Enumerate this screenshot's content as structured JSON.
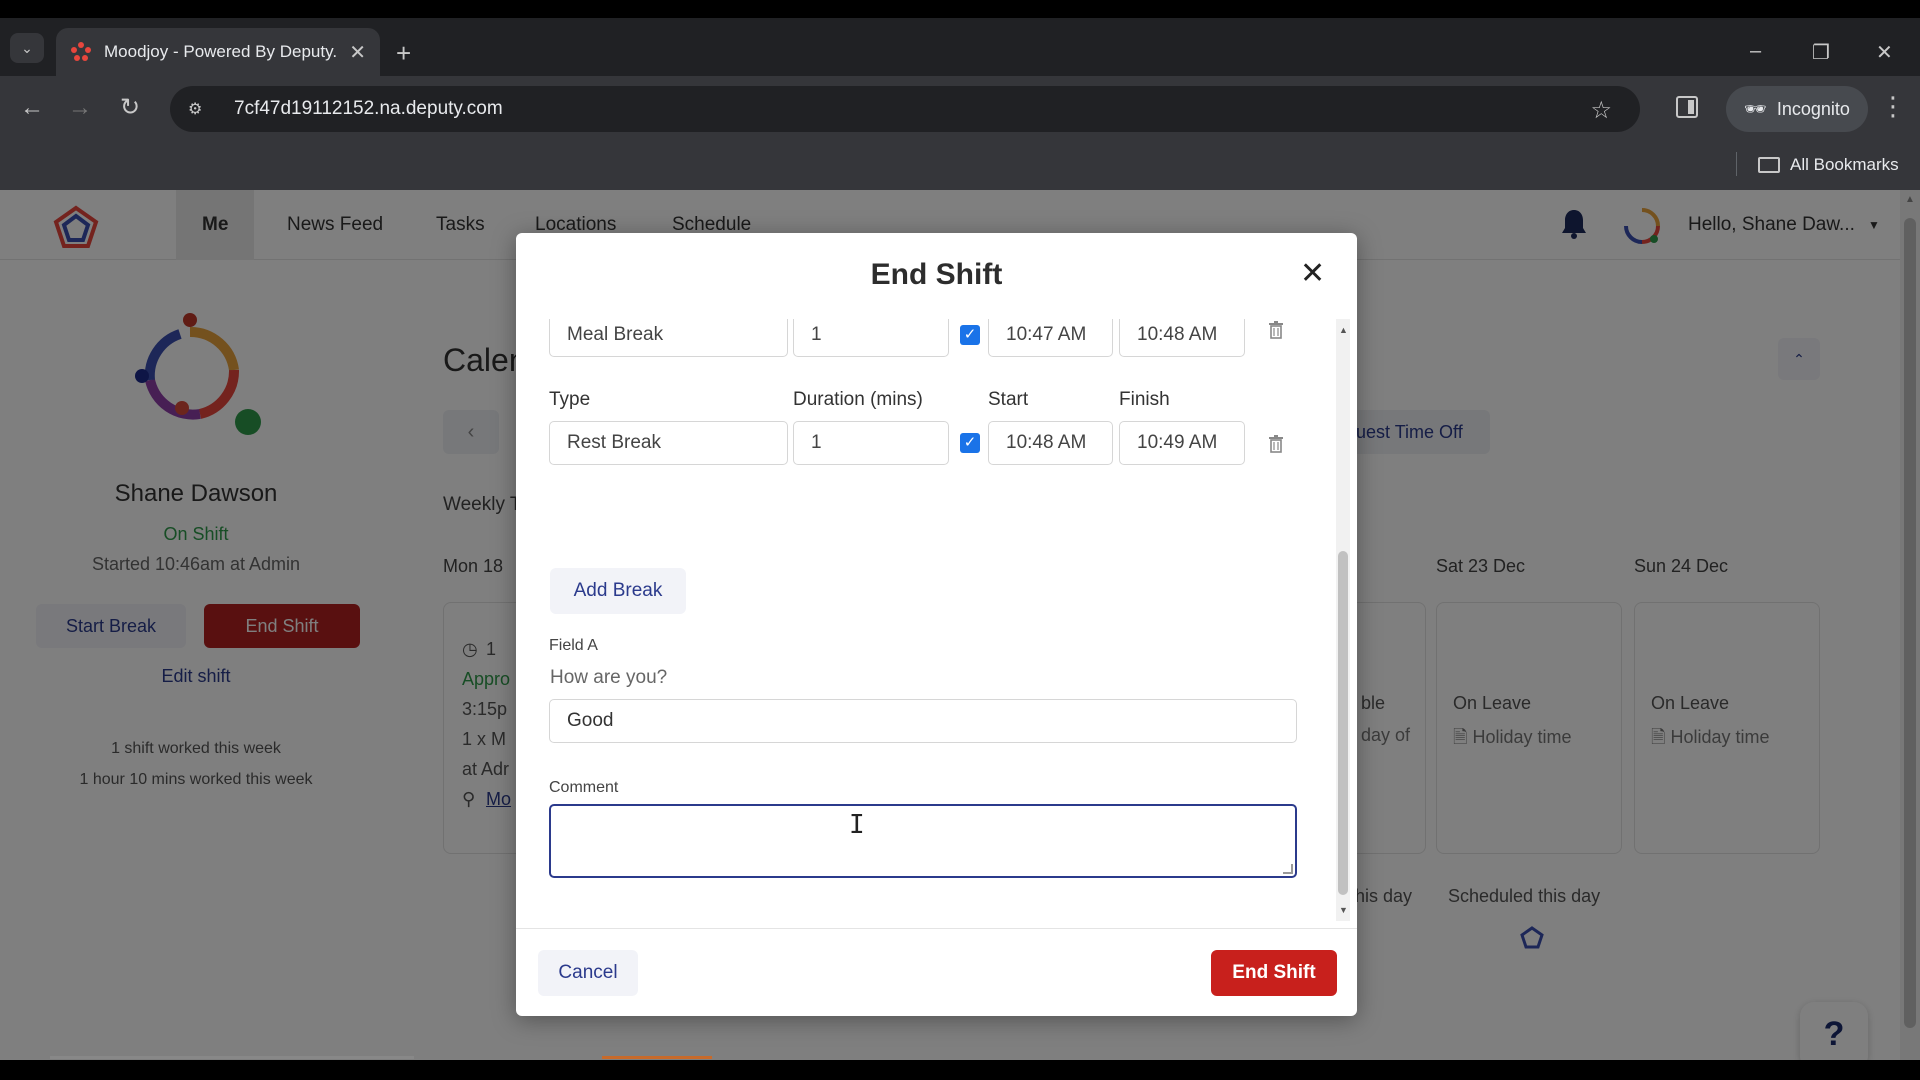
{
  "browser": {
    "tab_title": "Moodjoy - Powered By Deputy.",
    "url": "7cf47d19112152.na.deputy.com",
    "incognito_label": "Incognito",
    "bookmarks_label": "All Bookmarks"
  },
  "header": {
    "nav": [
      "Me",
      "News Feed",
      "Tasks",
      "Locations",
      "Schedule"
    ],
    "greeting": "Hello, Shane Daw..."
  },
  "profile": {
    "name": "Shane Dawson",
    "status": "On Shift",
    "started": "Started 10:46am at Admin",
    "start_break": "Start Break",
    "end_shift": "End Shift",
    "edit_shift": "Edit shift",
    "week_shifts": "1 shift worked this week",
    "week_hours": "1 hour 10 mins worked this week"
  },
  "calendar": {
    "title": "Calen",
    "request_time_off": "uest Time Off",
    "weekly": "Weekly T",
    "mon": "Mon 18",
    "sat": "Sat 23 Dec",
    "sun": "Sun 24 Dec",
    "on_leave": "On Leave",
    "holiday_time": "Holiday time",
    "scheduled": "Scheduled this day",
    "fri_partial_1": "ble",
    "fri_partial_2": "day of",
    "fri_sched_partial": "his day",
    "mon_partial": [
      "1",
      "Appro",
      "3:15p",
      "1 x M",
      "at Adr",
      "Mo"
    ]
  },
  "modal": {
    "title": "End Shift",
    "breaks": [
      {
        "type": "Meal Break",
        "duration": "1",
        "checked": true,
        "start": "10:47 AM",
        "finish": "10:48 AM"
      },
      {
        "type": "Rest Break",
        "duration": "1",
        "checked": true,
        "start": "10:48 AM",
        "finish": "10:49 AM"
      }
    ],
    "labels": {
      "type": "Type",
      "duration": "Duration (mins)",
      "start": "Start",
      "finish": "Finish"
    },
    "add_break": "Add Break",
    "field_a_label": "Field A",
    "field_a_question": "How are you?",
    "field_a_value": "Good",
    "comment_label": "Comment",
    "comment_value": "",
    "cancel": "Cancel",
    "end_shift": "End Shift"
  },
  "colors": {
    "primary_blue": "#2b3a8c",
    "end_shift_red": "#c8201c",
    "on_shift_green": "#2e9b4a",
    "checkbox_blue": "#1a73e8"
  }
}
